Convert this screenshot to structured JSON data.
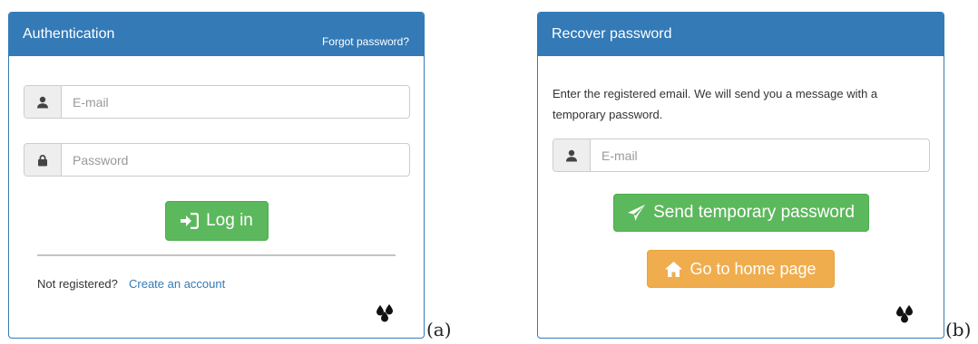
{
  "login_panel": {
    "title": "Authentication",
    "forgot_link": "Forgot password?",
    "email_placeholder": "E-mail",
    "password_placeholder": "Password",
    "login_button": "Log in",
    "not_registered_text": "Not registered?",
    "create_account_link": "Create an account",
    "figure_label": "(a)"
  },
  "recover_panel": {
    "title": "Recover password",
    "description": "Enter the registered email. We will send you a message with a temporary password.",
    "email_placeholder": "E-mail",
    "send_button": "Send temporary password",
    "home_button": "Go to home page",
    "figure_label": "(b)"
  },
  "colors": {
    "primary": "#337ab7",
    "success": "#5cb85c",
    "warning": "#f0ad4e"
  },
  "icons": {
    "email": "user-icon",
    "password": "lock-icon",
    "login": "sign-in-icon",
    "send": "paper-plane-icon",
    "home": "home-icon",
    "brand": "drops-logo-icon"
  }
}
